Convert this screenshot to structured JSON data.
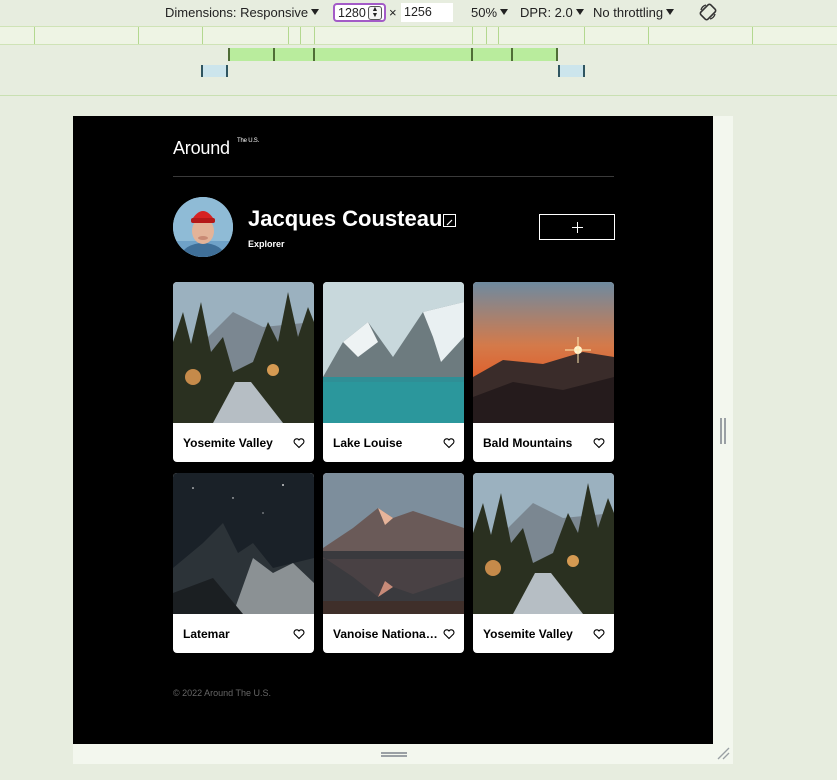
{
  "devtools": {
    "dimensions_label": "Dimensions: Responsive",
    "width_value": "1280",
    "times_symbol": "×",
    "height_value": "1256",
    "zoom_label": "50%",
    "dpr_label": "DPR: 2.0",
    "throttling_label": "No throttling"
  },
  "site": {
    "logo": "Around",
    "logo_sup": "The U.S."
  },
  "profile": {
    "name": "Jacques Cousteau",
    "description": "Explorer"
  },
  "cards": [
    {
      "title": "Yosemite Valley",
      "image": "forest-river"
    },
    {
      "title": "Lake Louise",
      "image": "mountain-lake"
    },
    {
      "title": "Bald Mountains",
      "image": "sunset"
    },
    {
      "title": "Latemar",
      "image": "night-peaks"
    },
    {
      "title": "Vanoise National Park",
      "image": "alpine-reflection"
    },
    {
      "title": "Yosemite Valley",
      "image": "forest-river"
    }
  ],
  "footer": {
    "copyright": "© 2022 Around The U.S."
  },
  "colors": {
    "page_bg": "#000000",
    "devtools_bg": "#e7eddf",
    "media_bar_green": "#b9ec9d",
    "media_bar_blue": "#cce5ec",
    "width_focus": "#a35bc7"
  }
}
